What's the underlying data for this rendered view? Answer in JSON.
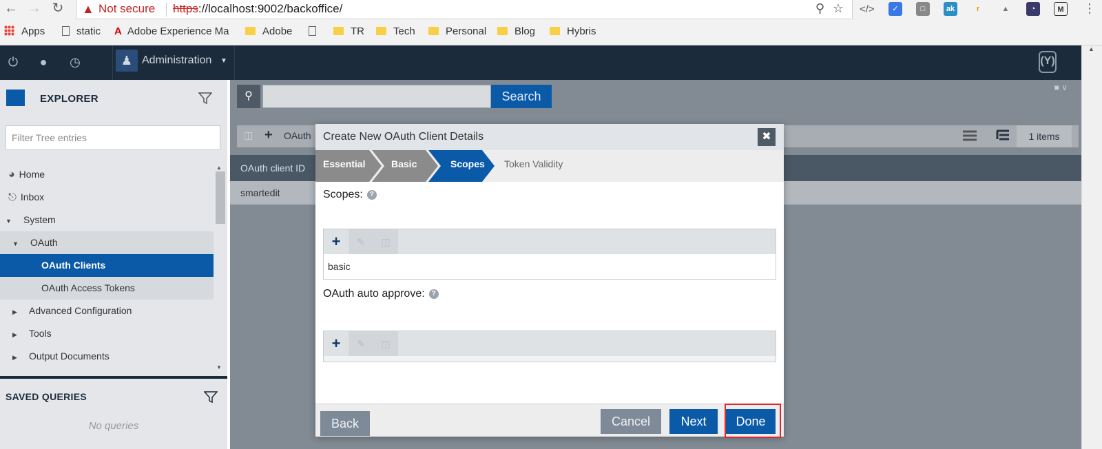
{
  "browser": {
    "security_label": "Not secure",
    "url_scheme": "https",
    "url_rest": "://localhost:9002/backoffice/",
    "bookmarks": [
      {
        "label": "Apps",
        "icon": "apps-grid-icon"
      },
      {
        "label": "static",
        "icon": "page-icon"
      },
      {
        "label": "Adobe Experience Ma",
        "icon": "adobe-icon"
      },
      {
        "label": "Adobe",
        "icon": "folder-icon"
      },
      {
        "label": "TR",
        "icon": "folder-icon"
      },
      {
        "label": "Tech",
        "icon": "folder-icon"
      },
      {
        "label": "Personal",
        "icon": "folder-icon"
      },
      {
        "label": "Blog",
        "icon": "folder-icon"
      },
      {
        "label": "Hybris",
        "icon": "folder-icon"
      }
    ]
  },
  "header": {
    "perspective_label": "Administration",
    "logo_text": "(Y)"
  },
  "sidebar": {
    "title": "EXPLORER",
    "filter_placeholder": "Filter Tree entries",
    "tree": [
      {
        "label": "Home",
        "icon": "home-icon"
      },
      {
        "label": "Inbox",
        "icon": "inbox-icon"
      },
      {
        "label": "System",
        "icon": "expand-icon"
      },
      {
        "label": "OAuth",
        "icon": "expand-icon"
      },
      {
        "label": "OAuth Clients",
        "selected": true
      },
      {
        "label": "OAuth Access Tokens"
      },
      {
        "label": "Advanced Configuration",
        "icon": "collapse-icon"
      },
      {
        "label": "Tools",
        "icon": "collapse-icon"
      },
      {
        "label": "Output Documents",
        "icon": "collapse-icon"
      }
    ],
    "saved_queries_title": "SAVED QUERIES",
    "no_queries": "No queries"
  },
  "main": {
    "search_button": "Search",
    "toolbar_label": "OAuth",
    "items_count": "1 items",
    "column_header": "OAuth client ID",
    "rows": [
      "smartedit"
    ]
  },
  "modal": {
    "title": "Create New OAuth Client Details",
    "steps": [
      {
        "label": "Essential",
        "state": "done"
      },
      {
        "label": "Basic",
        "state": "done"
      },
      {
        "label": "Scopes",
        "state": "active"
      },
      {
        "label": "Token Validity",
        "state": "pending"
      }
    ],
    "scopes_label": "Scopes:",
    "scopes_values": [
      "basic"
    ],
    "auto_approve_label": "OAuth auto approve:",
    "back_button": "Back",
    "cancel_button": "Cancel",
    "next_button": "Next",
    "done_button": "Done"
  },
  "colors": {
    "primary_blue": "#0a5aa8",
    "header_navy": "#1c2b3c",
    "highlight_red": "#e0262f"
  }
}
